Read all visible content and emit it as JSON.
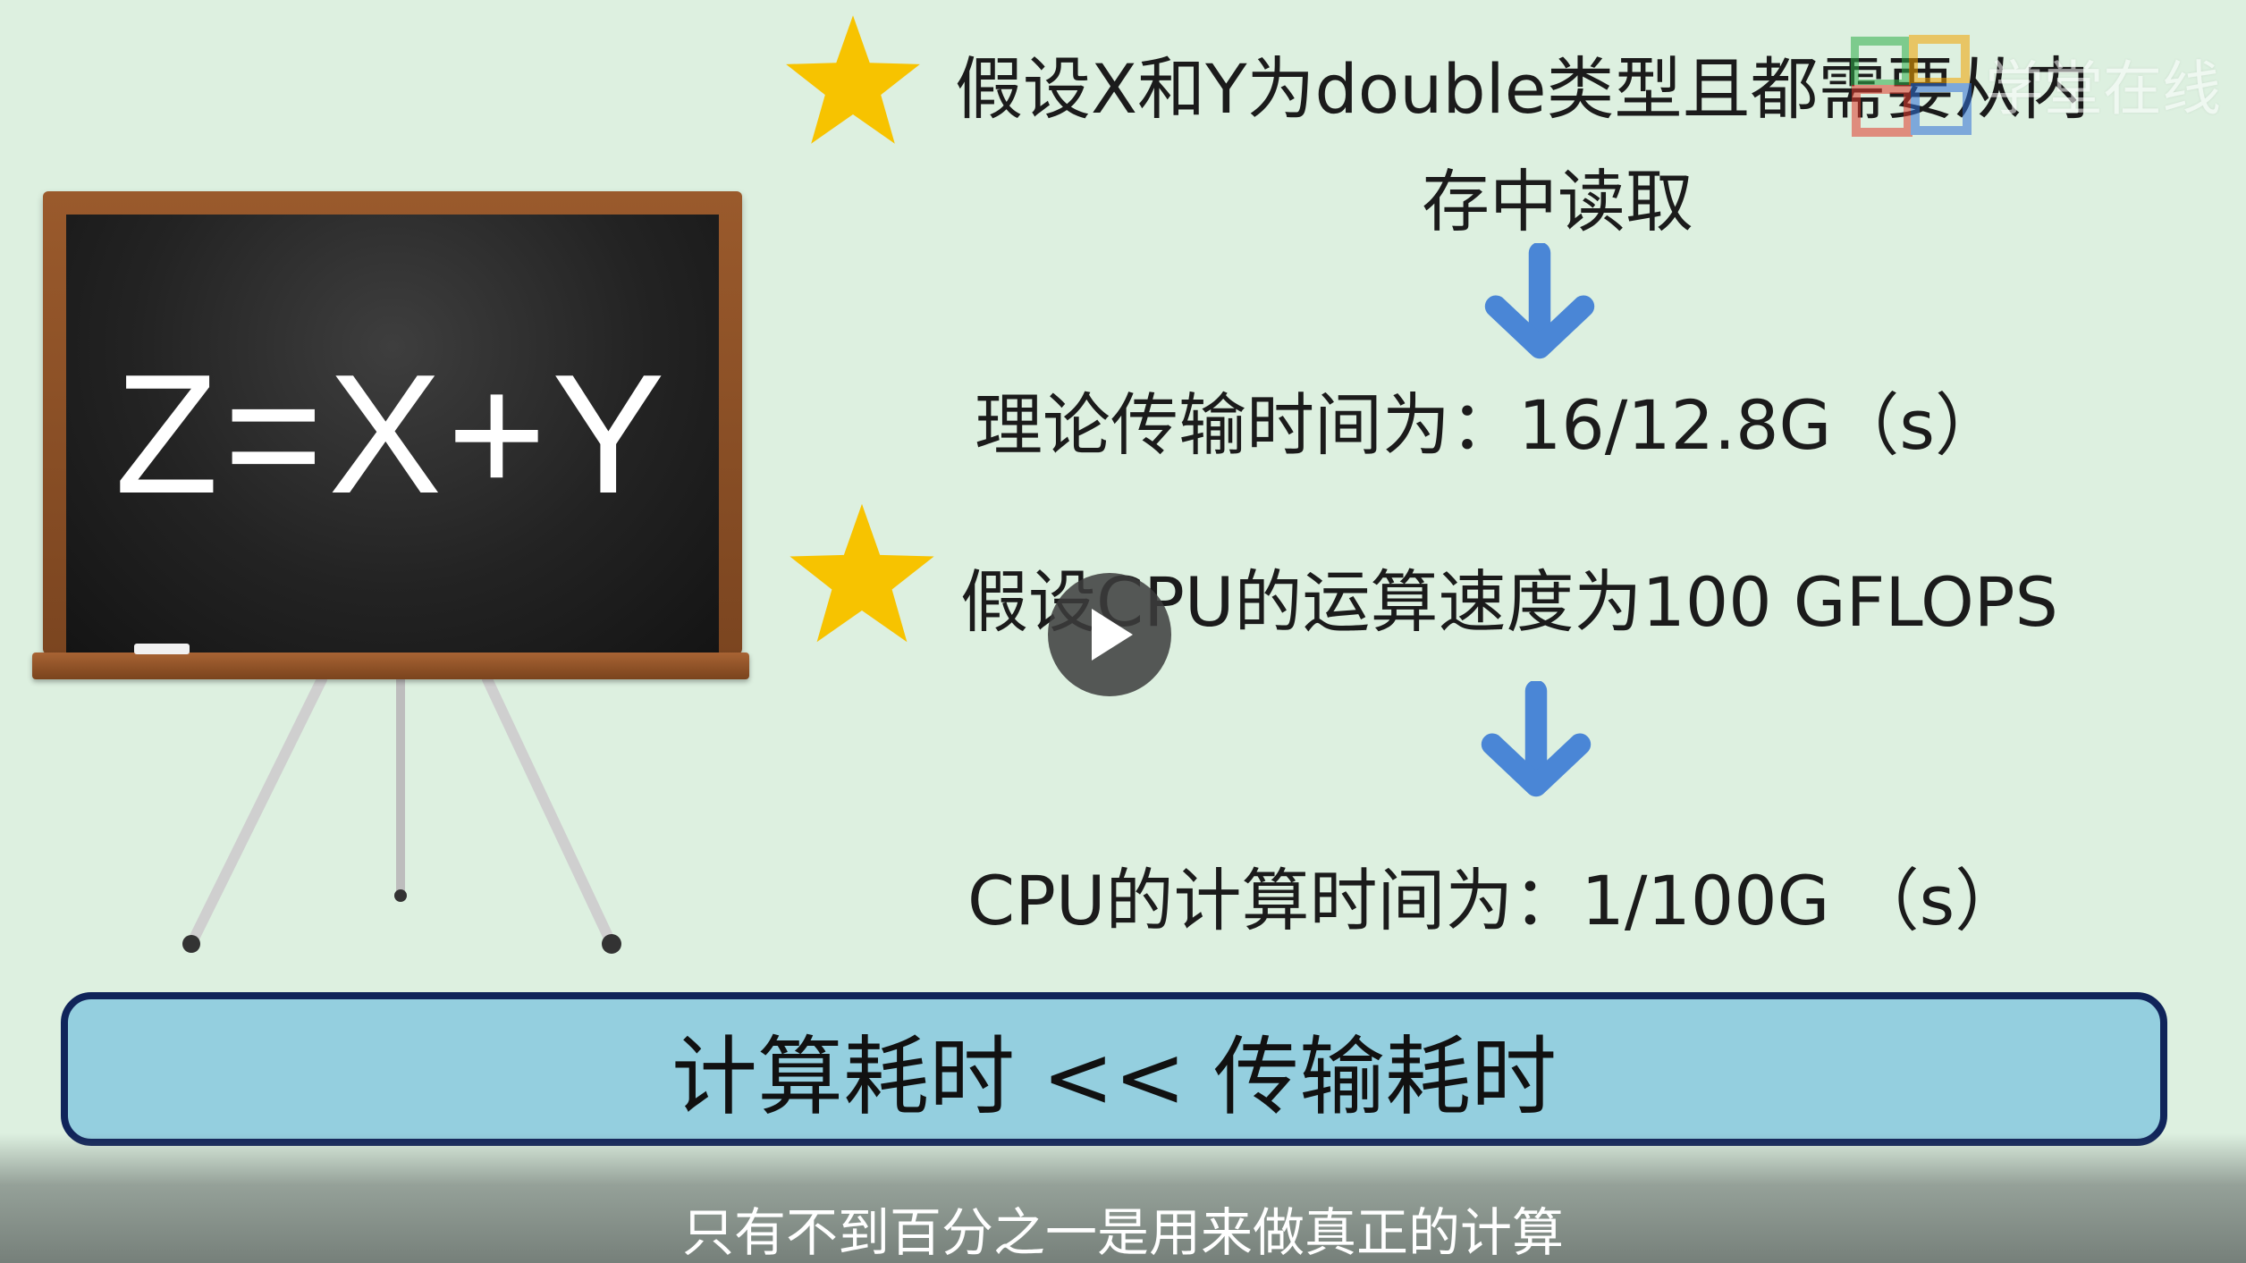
{
  "slide": {
    "formula": "Z=X+Y",
    "assumption_1_line1": "假设X和Y为double类型且都需要从内",
    "assumption_1_line2": "存中读取",
    "transfer_time": "理论传输时间为：16/12.8G（s）",
    "assumption_2": "假设CPU的运算速度为100 GFLOPS",
    "compute_time": "CPU的计算时间为：1/100G （s）",
    "conclusion": "计算耗时 << 传输耗时"
  },
  "subtitle": "只有不到百分之一是用来做真正的计算",
  "watermark": "学堂在线",
  "colors": {
    "background": "#ddf0e0",
    "star": "#f7c300",
    "arrow": "#4a86d6",
    "banner_fill": "#94cfdf",
    "banner_border": "#10245a"
  },
  "icons": {
    "bullet": "star-icon",
    "flow": "arrow-down-icon",
    "player": "play-icon"
  }
}
